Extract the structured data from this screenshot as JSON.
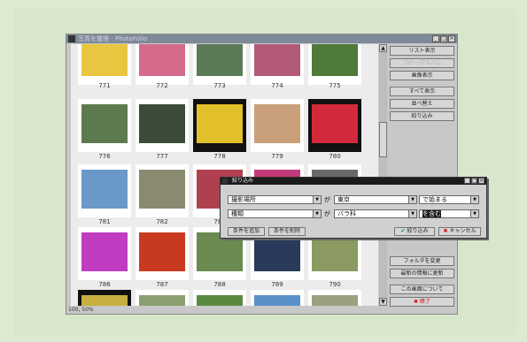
{
  "window": {
    "title": "写真を整理 - PhotoFolio"
  },
  "status_text": "100, 50%",
  "thumbs_row1": [
    {
      "num": "771",
      "color": "#e8c640"
    },
    {
      "num": "772",
      "color": "#d46b8a"
    },
    {
      "num": "773",
      "color": "#5a7a58"
    },
    {
      "num": "774",
      "color": "#b25a78"
    },
    {
      "num": "775",
      "color": "#4f7a3a"
    }
  ],
  "thumbs_row2": [
    {
      "num": "776",
      "color": "#5d7a4e"
    },
    {
      "num": "777",
      "color": "#3c4a3a"
    },
    {
      "num": "778",
      "color": "#e2c02a"
    },
    {
      "num": "779",
      "color": "#c9a07a"
    },
    {
      "num": "780",
      "color": "#d22a3a"
    }
  ],
  "thumbs_row3": [
    {
      "num": "781",
      "color": "#6a98c8"
    },
    {
      "num": "782",
      "color": "#8a8a70"
    },
    {
      "num": "783",
      "color": "#b04050"
    },
    {
      "num": "784",
      "color": "#c23a7a"
    },
    {
      "num": "785",
      "color": "#6a6a6a"
    }
  ],
  "thumbs_row4": [
    {
      "num": "786",
      "color": "#c03cc0"
    },
    {
      "num": "787",
      "color": "#c83a20"
    },
    {
      "num": "788",
      "color": "#6a8a50"
    },
    {
      "num": "789",
      "color": "#2a3a5a"
    },
    {
      "num": "790",
      "color": "#8a9a60"
    }
  ],
  "thumbs_row5": [
    {
      "num": "",
      "color": "#c8b040"
    },
    {
      "num": "",
      "color": "#8aa070"
    },
    {
      "num": "",
      "color": "#5a8a40"
    },
    {
      "num": "",
      "color": "#5a90c8"
    },
    {
      "num": "",
      "color": "#9aa080"
    }
  ],
  "side_buttons": {
    "list_view": "リスト表示",
    "copy": "コピー/アルバム",
    "slideshow": "画像表示",
    "show_all": "すべて表示",
    "sort": "並べ替え",
    "filter": "絞り込み",
    "folder_change": "フォルダを変更",
    "update": "最新の情報に更新",
    "about": "この画面について",
    "exit": "終了"
  },
  "dialog": {
    "title": "絞り込み",
    "field1": "撮影場所",
    "ga1": "が",
    "value1": "東京",
    "cond1": "で始まる",
    "field2": "種類",
    "ga2": "が",
    "value2": "バラ科",
    "cond2": "を含む",
    "add_condition": "条件を追加",
    "remove_condition": "条件を削除",
    "filter_button": "絞り込み",
    "cancel_button": "キャンセル"
  },
  "colors": {
    "accent_green": "#1a8a1a",
    "accent_red": "#cc0000",
    "titlebar": "#7f8a98"
  }
}
